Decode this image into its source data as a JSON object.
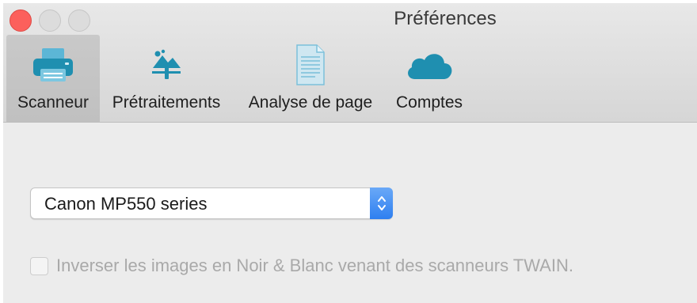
{
  "window": {
    "title": "Préférences"
  },
  "toolbar": {
    "tabs": [
      {
        "label": "Scanneur",
        "icon": "scanner-icon",
        "selected": true
      },
      {
        "label": "Prétraitements",
        "icon": "image-adjust-icon",
        "selected": false
      },
      {
        "label": "Analyse de page",
        "icon": "page-document-icon",
        "selected": false
      },
      {
        "label": "Comptes",
        "icon": "cloud-icon",
        "selected": false
      }
    ]
  },
  "scanner": {
    "selected_device": "Canon MP550 series",
    "invert_checkbox_label": "Inverser les images en Noir & Blanc venant des scanneurs TWAIN.",
    "invert_checked": false,
    "invert_enabled": false
  },
  "colors": {
    "accent": "#2e7ff0",
    "icon_teal": "#1f8fb0",
    "close_button": "#fc605c"
  }
}
